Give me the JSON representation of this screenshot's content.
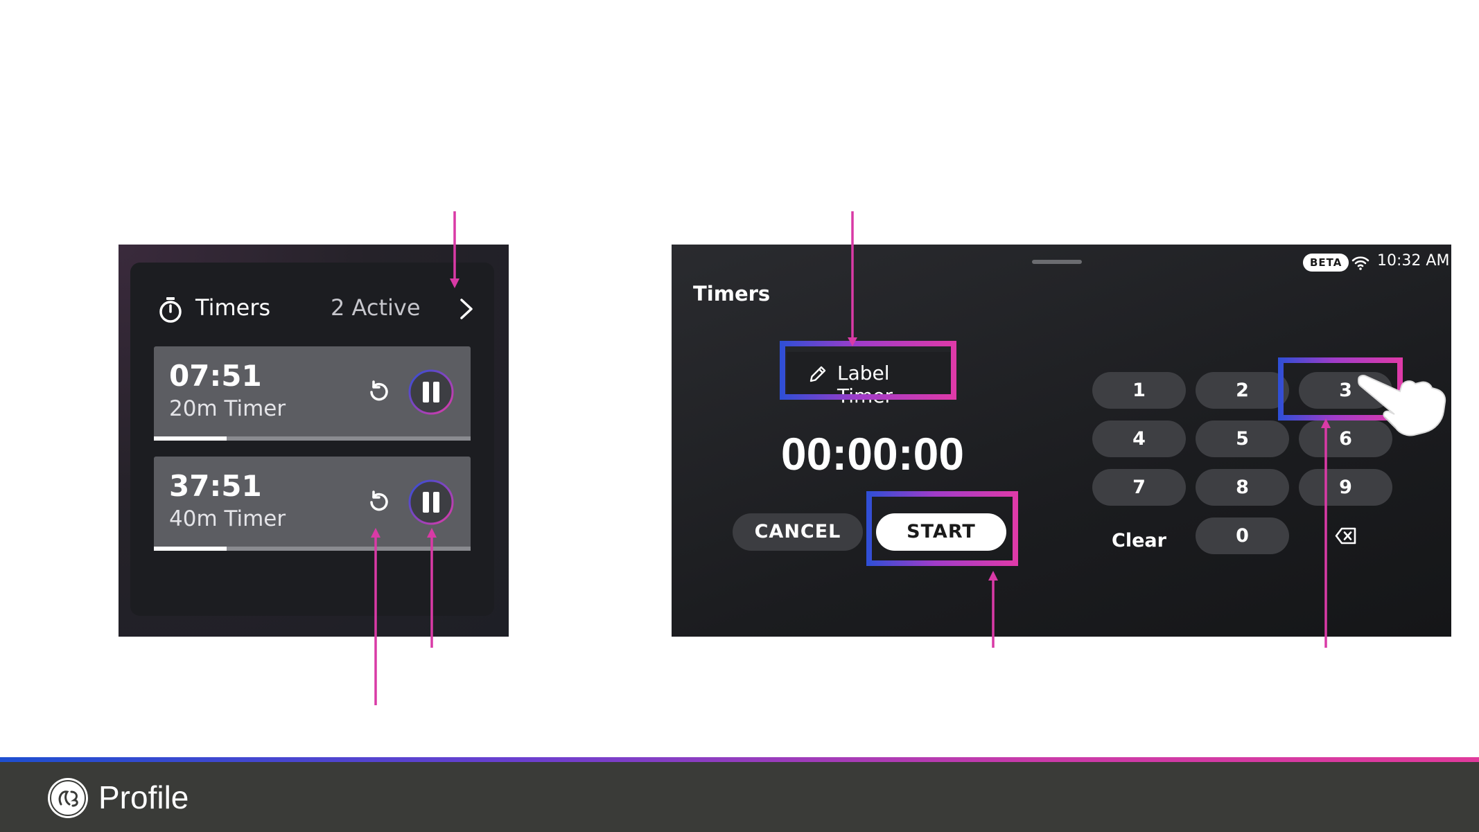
{
  "widget": {
    "title": "Timers",
    "active_count": "2 Active",
    "timers": [
      {
        "time": "07:51",
        "name": "20m Timer",
        "progress": 0.23
      },
      {
        "time": "37:51",
        "name": "40m Timer",
        "progress": 0.23
      }
    ]
  },
  "panel": {
    "status": {
      "beta": "BETA",
      "time": "10:32 AM"
    },
    "title": "Timers",
    "label_button": "Label Timer",
    "time_display": "00:00:00",
    "cancel_label": "CANCEL",
    "start_label": "START",
    "keypad": [
      "1",
      "2",
      "3",
      "4",
      "5",
      "6",
      "7",
      "8",
      "9",
      "Clear",
      "0"
    ]
  },
  "footer": {
    "brand": "Profile"
  },
  "colors": {
    "accent_magenta": "#d93aa6",
    "accent_blue": "#2d4fd6",
    "footer_bg": "#3a3b38"
  },
  "icons": [
    "stopwatch-icon",
    "chevron-right-icon",
    "reset-icon",
    "pause-icon",
    "pencil-icon",
    "wifi-icon",
    "backspace-icon",
    "hand-pointer-icon",
    "ge-logo-icon"
  ]
}
